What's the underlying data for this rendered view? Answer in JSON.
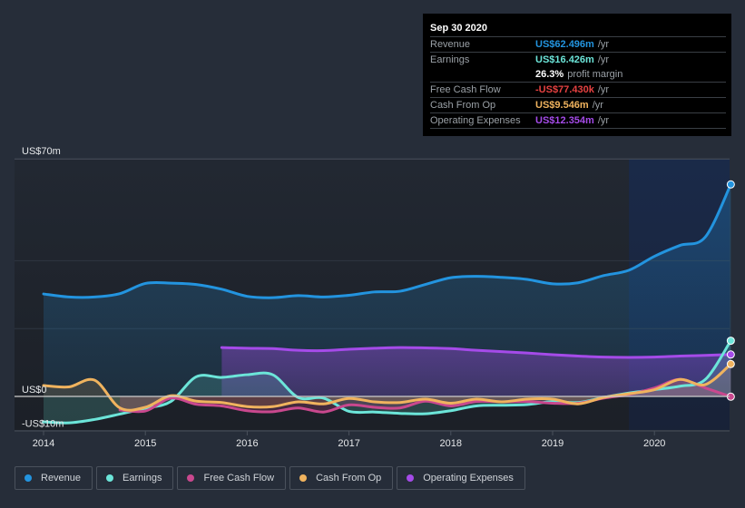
{
  "tooltip": {
    "date": "Sep 30 2020",
    "rows": [
      {
        "label": "Revenue",
        "value": "US$62.496m",
        "unit": "/yr",
        "color": "#2394df"
      },
      {
        "label": "Earnings",
        "value": "US$16.426m",
        "unit": "/yr",
        "color": "#6ce5d9"
      },
      {
        "label": "",
        "value": "26.3%",
        "unit": "profit margin",
        "color": "#ffffff"
      },
      {
        "label": "Free Cash Flow",
        "value": "-US$77.430k",
        "unit": "/yr",
        "color": "#e64141"
      },
      {
        "label": "Cash From Op",
        "value": "US$9.546m",
        "unit": "/yr",
        "color": "#f0b35e"
      },
      {
        "label": "Operating Expenses",
        "value": "US$12.354m",
        "unit": "/yr",
        "color": "#a54be9"
      }
    ]
  },
  "legend": [
    {
      "label": "Revenue",
      "color": "#2394df"
    },
    {
      "label": "Earnings",
      "color": "#6ce5d9"
    },
    {
      "label": "Free Cash Flow",
      "color": "#c9488e"
    },
    {
      "label": "Cash From Op",
      "color": "#f0b35e"
    },
    {
      "label": "Operating Expenses",
      "color": "#a54be9"
    }
  ],
  "chart_data": {
    "type": "line",
    "title": "",
    "xlabel": "",
    "ylabel": "",
    "xlim": [
      2013.7,
      2020.75
    ],
    "ylim": [
      -10,
      70
    ],
    "y_tick_labels": [
      {
        "value": 70,
        "label": "US$70m"
      },
      {
        "value": 0,
        "label": "US$0"
      },
      {
        "value": -10,
        "label": "-US$10m"
      }
    ],
    "gridlines": [
      70,
      40,
      20,
      0
    ],
    "x_ticks": [
      2014,
      2015,
      2016,
      2017,
      2018,
      2019,
      2020
    ],
    "x_tick_labels": [
      "2014",
      "2015",
      "2016",
      "2017",
      "2018",
      "2019",
      "2020"
    ],
    "highlight_from": 2019.75,
    "series": [
      {
        "name": "Revenue",
        "color": "#2394df",
        "x": [
          2014.0,
          2014.25,
          2014.5,
          2014.75,
          2015.0,
          2015.25,
          2015.5,
          2015.75,
          2016.0,
          2016.25,
          2016.5,
          2016.75,
          2017.0,
          2017.25,
          2017.5,
          2017.75,
          2018.0,
          2018.25,
          2018.5,
          2018.75,
          2019.0,
          2019.25,
          2019.5,
          2019.75,
          2020.0,
          2020.25,
          2020.5,
          2020.75
        ],
        "values": [
          30.2,
          29.3,
          29.3,
          30.3,
          33.3,
          33.4,
          33.0,
          31.6,
          29.5,
          29.1,
          29.7,
          29.3,
          29.8,
          30.8,
          31.0,
          33.0,
          35.0,
          35.4,
          35.1,
          34.5,
          33.2,
          33.5,
          35.6,
          37.2,
          41.3,
          44.5,
          47.0,
          62.496
        ]
      },
      {
        "name": "Earnings",
        "color": "#6ce5d9",
        "x": [
          2014.0,
          2014.25,
          2014.5,
          2014.75,
          2015.0,
          2015.25,
          2015.5,
          2015.75,
          2016.0,
          2016.25,
          2016.5,
          2016.75,
          2017.0,
          2017.25,
          2017.5,
          2017.75,
          2018.0,
          2018.25,
          2018.5,
          2018.75,
          2019.0,
          2019.25,
          2019.5,
          2019.75,
          2020.0,
          2020.25,
          2020.5,
          2020.75
        ],
        "values": [
          -7.5,
          -7.8,
          -6.8,
          -5.2,
          -3.5,
          -1.5,
          5.8,
          5.6,
          6.4,
          6.4,
          -0.3,
          -0.5,
          -4.4,
          -4.6,
          -5.0,
          -5.1,
          -4.2,
          -2.8,
          -2.6,
          -2.4,
          -1.5,
          -1.8,
          -0.3,
          1.0,
          2.0,
          3.0,
          5.0,
          16.426
        ]
      },
      {
        "name": "Free Cash Flow",
        "color": "#c9488e",
        "x": [
          2014.75,
          2015.0,
          2015.25,
          2015.5,
          2015.75,
          2016.0,
          2016.25,
          2016.5,
          2016.75,
          2017.0,
          2017.25,
          2017.5,
          2017.75,
          2018.0,
          2018.25,
          2018.5,
          2018.75,
          2019.0,
          2019.25,
          2019.5,
          2019.75,
          2020.0,
          2020.25,
          2020.5,
          2020.75
        ],
        "values": [
          -4.0,
          -4.3,
          -0.5,
          -2.3,
          -2.8,
          -4.2,
          -4.5,
          -3.4,
          -4.6,
          -2.5,
          -3.2,
          -3.4,
          -1.4,
          -2.8,
          -1.5,
          -1.6,
          -1.5,
          -2.0,
          -2.0,
          -0.5,
          0.6,
          2.5,
          5.0,
          2.5,
          -0.077
        ]
      },
      {
        "name": "Cash From Op",
        "color": "#f0b35e",
        "x": [
          2014.0,
          2014.25,
          2014.5,
          2014.75,
          2015.0,
          2015.25,
          2015.5,
          2015.75,
          2016.0,
          2016.25,
          2016.5,
          2016.75,
          2017.0,
          2017.25,
          2017.5,
          2017.75,
          2018.0,
          2018.25,
          2018.5,
          2018.75,
          2019.0,
          2019.25,
          2019.5,
          2019.75,
          2020.0,
          2020.25,
          2020.5,
          2020.75
        ],
        "values": [
          3.2,
          2.8,
          4.8,
          -3.4,
          -3.2,
          0.2,
          -1.4,
          -1.8,
          -3.0,
          -3.0,
          -1.6,
          -2.2,
          -0.6,
          -1.6,
          -1.8,
          -0.8,
          -2.0,
          -0.8,
          -1.6,
          -0.8,
          -0.8,
          -2.2,
          -0.3,
          0.8,
          2.0,
          5.0,
          3.5,
          9.546
        ]
      },
      {
        "name": "Operating Expenses",
        "color": "#a54be9",
        "x": [
          2015.75,
          2016.0,
          2016.25,
          2016.5,
          2016.75,
          2017.0,
          2017.25,
          2017.5,
          2017.75,
          2018.0,
          2018.25,
          2018.5,
          2018.75,
          2019.0,
          2019.25,
          2019.5,
          2019.75,
          2020.0,
          2020.25,
          2020.5,
          2020.75
        ],
        "values": [
          14.4,
          14.2,
          14.1,
          13.6,
          13.5,
          13.9,
          14.2,
          14.4,
          14.3,
          14.1,
          13.6,
          13.2,
          12.8,
          12.3,
          11.9,
          11.6,
          11.5,
          11.6,
          11.9,
          12.1,
          12.354
        ]
      }
    ]
  }
}
